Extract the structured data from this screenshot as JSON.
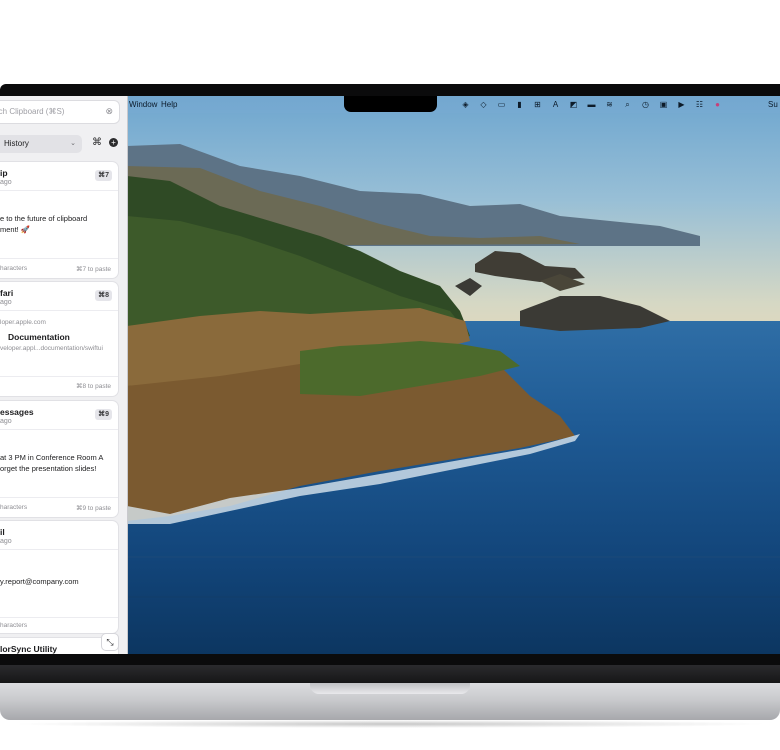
{
  "menubar": {
    "items": [
      "Window",
      "Help"
    ],
    "status_text": "Su",
    "tray_icons": [
      "fox-icon",
      "layers-icon",
      "window-icon",
      "bookmark-icon",
      "grid-icon",
      "text-a-icon",
      "shortcut-icon",
      "battery-icon",
      "wifi-icon",
      "search-icon",
      "history-icon",
      "clipboard-icon",
      "play-icon",
      "control-center-icon",
      "siri-icon"
    ]
  },
  "clipboard": {
    "search_placeholder": "rch Clipboard (⌘S)",
    "filter_label": "History",
    "cards": [
      {
        "title": "ip",
        "subtitle": "ago",
        "shortcut": "⌘7",
        "body_lines": [
          "e to the future of clipboard",
          "ment! 🚀"
        ],
        "footer_left": "haracters",
        "footer_right": "⌘7 to paste"
      },
      {
        "title": "fari",
        "subtitle": "ago",
        "shortcut": "⌘8",
        "url": "loper.apple.com",
        "heading": "Documentation",
        "link": "veloper.appl...documentation/swiftui",
        "footer_right": "⌘8 to paste"
      },
      {
        "title": "essages",
        "subtitle": "ago",
        "shortcut": "⌘9",
        "body_lines": [
          "at 3 PM in Conference Room A",
          "orget the presentation slides!"
        ],
        "footer_left": "haracters",
        "footer_right": "⌘9 to paste"
      },
      {
        "title": "il",
        "subtitle": "ago",
        "body_lines": [
          "y.report@company.com"
        ],
        "footer_left": "haracters"
      },
      {
        "title": "lorSync Utility"
      }
    ]
  }
}
